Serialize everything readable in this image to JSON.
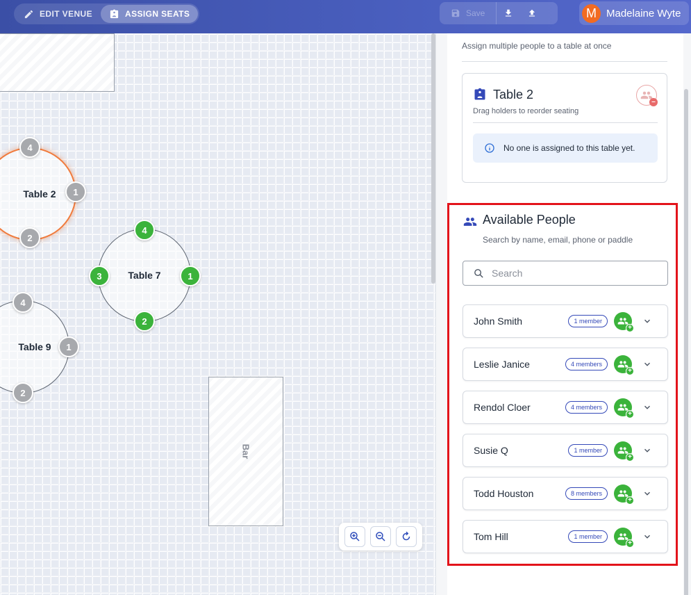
{
  "topbar": {
    "edit_venue_label": "EDIT VENUE",
    "assign_seats_label": "ASSIGN SEATS",
    "save_label": "Save",
    "user_name": "Madelaine Wyte",
    "user_initial": "M",
    "brand_color": "#3b4fa6",
    "avatar_color": "#f26b22"
  },
  "canvas": {
    "bar_label": "Bar",
    "tables": [
      {
        "label": "Table 2",
        "seats": [
          "4",
          "1",
          "2"
        ],
        "selected": true
      },
      {
        "label": "Table 7",
        "seats": [
          "4",
          "1",
          "2",
          "3"
        ],
        "selected": false
      },
      {
        "label": "Table 9",
        "seats": [
          "4",
          "1",
          "2"
        ],
        "selected": false
      }
    ],
    "seat_assigned_color": "#3bb33b",
    "seat_empty_color": "#a7a9ad",
    "selected_color": "#f07a3b"
  },
  "panel": {
    "hint": "Assign multiple people to a table at once",
    "table_card": {
      "title": "Table 2",
      "subtitle": "Drag holders to reorder seating",
      "empty_message": "No one is assigned to this table yet."
    },
    "available": {
      "title": "Available People",
      "subtitle": "Search by name, email, phone or paddle",
      "search_placeholder": "Search",
      "people": [
        {
          "name": "John Smith",
          "members": "1 member"
        },
        {
          "name": "Leslie Janice",
          "members": "4 members"
        },
        {
          "name": "Rendol Cloer",
          "members": "4 members"
        },
        {
          "name": "Susie Q",
          "members": "1 member"
        },
        {
          "name": "Todd Houston",
          "members": "8 members"
        },
        {
          "name": "Tom Hill",
          "members": "1 member"
        }
      ]
    }
  }
}
